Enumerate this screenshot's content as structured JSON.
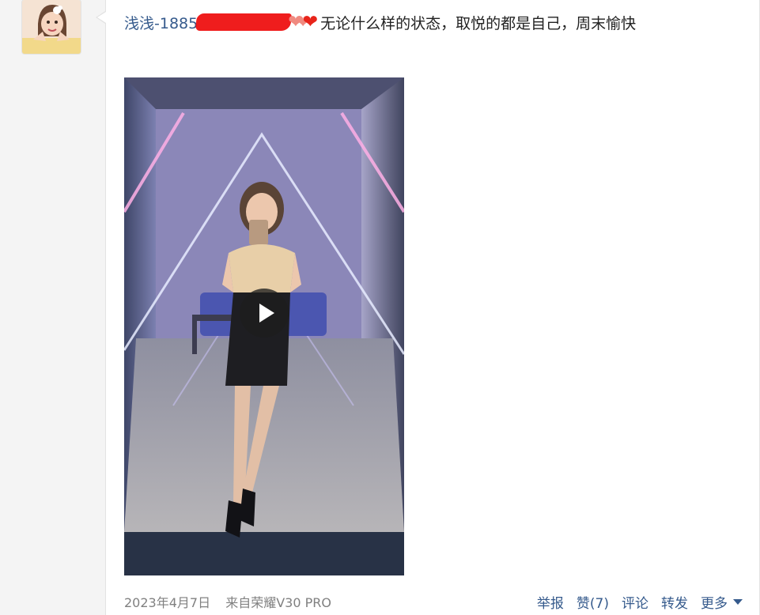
{
  "post": {
    "username": "浅浅-1885",
    "text": "无论什么样的状态，取悦的都是自己，周末愉快"
  },
  "video": {
    "play_icon": "play-icon"
  },
  "footer": {
    "date": "2023年4月7日",
    "source": "来自荣耀V30 PRO",
    "report": "举报",
    "like": "赞(7)",
    "comment": "评论",
    "repost": "转发",
    "more": "更多"
  },
  "colors": {
    "link": "#355a8c",
    "text": "#222222",
    "meta": "#808080",
    "heart": "#e8241a"
  }
}
